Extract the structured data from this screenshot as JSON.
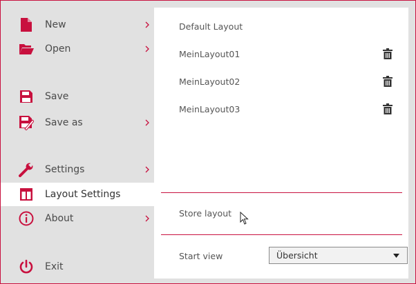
{
  "sidebar": {
    "items": [
      {
        "label": "New"
      },
      {
        "label": "Open"
      },
      {
        "label": "Save"
      },
      {
        "label": "Save as"
      },
      {
        "label": "Settings"
      },
      {
        "label": "Layout Settings"
      },
      {
        "label": "About"
      },
      {
        "label": "Exit"
      }
    ]
  },
  "layouts": {
    "items": [
      {
        "name": "Default Layout"
      },
      {
        "name": "MeinLayout01"
      },
      {
        "name": "MeinLayout02"
      },
      {
        "name": "MeinLayout03"
      }
    ]
  },
  "actions": {
    "store_label": "Store layout"
  },
  "start_view": {
    "label": "Start view",
    "value": "Übersicht"
  },
  "colors": {
    "accent": "#c8103e",
    "sidebar_bg": "#e1e1e1",
    "panel_bg": "#ffffff"
  }
}
